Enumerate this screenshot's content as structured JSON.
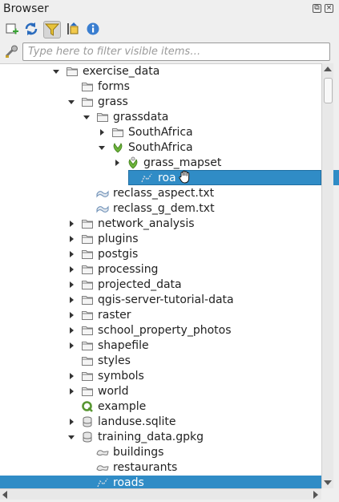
{
  "panel": {
    "title": "Browser",
    "float_btn": "⧉",
    "close_btn": "×"
  },
  "filter": {
    "placeholder": "Type here to filter visible items…",
    "value": ""
  },
  "tree": [
    {
      "label": "exercise_data",
      "icon": "folder-icon",
      "arrow": "open",
      "indent": 0
    },
    {
      "label": "forms",
      "icon": "folder-icon",
      "arrow": "none",
      "indent": 1
    },
    {
      "label": "grass",
      "icon": "folder-icon",
      "arrow": "open",
      "indent": 1
    },
    {
      "label": "grassdata",
      "icon": "folder-icon",
      "arrow": "open",
      "indent": 2
    },
    {
      "label": "SouthAfrica",
      "icon": "folder-icon",
      "arrow": "closed",
      "indent": 3
    },
    {
      "label": "SouthAfrica",
      "icon": "grass-location-icon",
      "arrow": "open",
      "indent": 3
    },
    {
      "label": "grass_mapset",
      "icon": "grass-mapset-icon",
      "arrow": "closed",
      "indent": 4
    },
    {
      "label": "roa",
      "icon": "vector-line-icon",
      "arrow": "none",
      "indent": 5,
      "drag": true
    },
    {
      "label": "reclass_aspect.txt",
      "icon": "raster-file-icon",
      "arrow": "none",
      "indent": 2
    },
    {
      "label": "reclass_g_dem.txt",
      "icon": "raster-file-icon",
      "arrow": "none",
      "indent": 2
    },
    {
      "label": "network_analysis",
      "icon": "folder-icon",
      "arrow": "closed",
      "indent": 1
    },
    {
      "label": "plugins",
      "icon": "folder-icon",
      "arrow": "closed",
      "indent": 1
    },
    {
      "label": "postgis",
      "icon": "folder-icon",
      "arrow": "closed",
      "indent": 1
    },
    {
      "label": "processing",
      "icon": "folder-icon",
      "arrow": "closed",
      "indent": 1
    },
    {
      "label": "projected_data",
      "icon": "folder-icon",
      "arrow": "closed",
      "indent": 1
    },
    {
      "label": "qgis-server-tutorial-data",
      "icon": "folder-icon",
      "arrow": "closed",
      "indent": 1
    },
    {
      "label": "raster",
      "icon": "folder-icon",
      "arrow": "closed",
      "indent": 1
    },
    {
      "label": "school_property_photos",
      "icon": "folder-icon",
      "arrow": "closed",
      "indent": 1
    },
    {
      "label": "shapefile",
      "icon": "folder-icon",
      "arrow": "closed",
      "indent": 1
    },
    {
      "label": "styles",
      "icon": "folder-icon",
      "arrow": "none",
      "indent": 1
    },
    {
      "label": "symbols",
      "icon": "folder-icon",
      "arrow": "closed",
      "indent": 1
    },
    {
      "label": "world",
      "icon": "folder-icon",
      "arrow": "closed",
      "indent": 1
    },
    {
      "label": "example",
      "icon": "qgis-project-icon",
      "arrow": "none",
      "indent": 1
    },
    {
      "label": "landuse.sqlite",
      "icon": "database-icon",
      "arrow": "closed",
      "indent": 1
    },
    {
      "label": "training_data.gpkg",
      "icon": "database-icon",
      "arrow": "open",
      "indent": 1
    },
    {
      "label": "buildings",
      "icon": "polygon-layer-icon",
      "arrow": "none",
      "indent": 2
    },
    {
      "label": "restaurants",
      "icon": "polygon-layer-icon",
      "arrow": "none",
      "indent": 2
    },
    {
      "label": "roads",
      "icon": "vector-line-icon",
      "arrow": "none",
      "indent": 2,
      "selected": true
    }
  ],
  "colors": {
    "selection": "#308cc6",
    "folder": "#8a8a8a",
    "refresh": "#2a6bbd",
    "filter": "#d9a71a",
    "info": "#3a7ed0",
    "qgis": "#589632"
  }
}
